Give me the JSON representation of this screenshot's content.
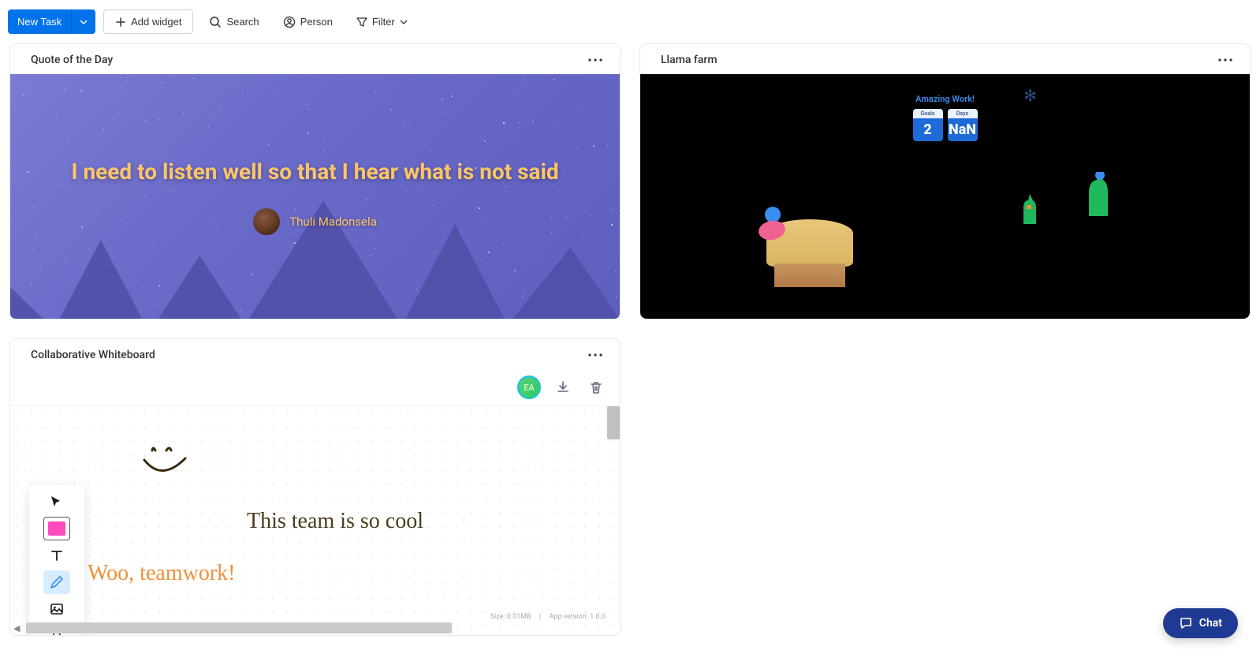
{
  "toolbar": {
    "new_task": "New Task",
    "add_widget": "Add widget",
    "search": "Search",
    "person": "Person",
    "filter": "Filter"
  },
  "widgets": {
    "quote": {
      "title": "Quote of the Day",
      "text": "I need to listen well so that I hear what is not said",
      "author": "Thuli Madonsela"
    },
    "llama": {
      "title": "Llama farm",
      "banner": "Amazing Work!",
      "cards": [
        {
          "label": "Goals",
          "value": "2"
        },
        {
          "label": "Days",
          "value": "NaN"
        }
      ]
    },
    "whiteboard": {
      "title": "Collaborative Whiteboard",
      "avatar": "EA",
      "text1": "This team is so cool",
      "text2": "Woo, teamwork!",
      "footer_size": "Size: 0.01MB",
      "footer_version": "App version: 1.0.0"
    }
  },
  "chat": {
    "label": "Chat"
  }
}
